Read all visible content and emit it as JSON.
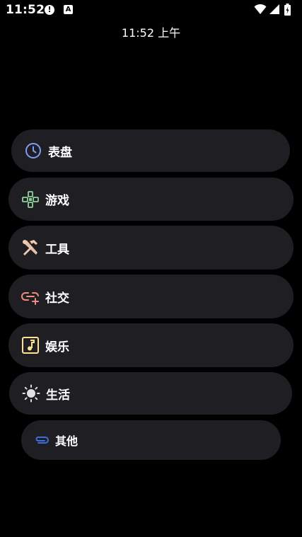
{
  "status_bar": {
    "time": "11:52",
    "alert_glyph": "!",
    "a_glyph": "A",
    "icons": [
      "wifi-icon",
      "signal-icon",
      "battery-icon"
    ]
  },
  "watch_face": {
    "time_text": "11:52 上午"
  },
  "categories": [
    {
      "label": "表盘",
      "icon": "clock-icon",
      "color": "#7f9cf5"
    },
    {
      "label": "游戏",
      "icon": "gamepad-icon",
      "color": "#8fd19e"
    },
    {
      "label": "工具",
      "icon": "tools-icon",
      "color": "#f2c8b0"
    },
    {
      "label": "社交",
      "icon": "link-add-icon",
      "color": "#f28b82"
    },
    {
      "label": "娱乐",
      "icon": "music-note-icon",
      "color": "#fde293"
    },
    {
      "label": "生活",
      "icon": "sun-icon",
      "color": "#e0e0e0"
    },
    {
      "label": "其他",
      "icon": "paperclip-icon",
      "color": "#3b6fd8"
    }
  ]
}
